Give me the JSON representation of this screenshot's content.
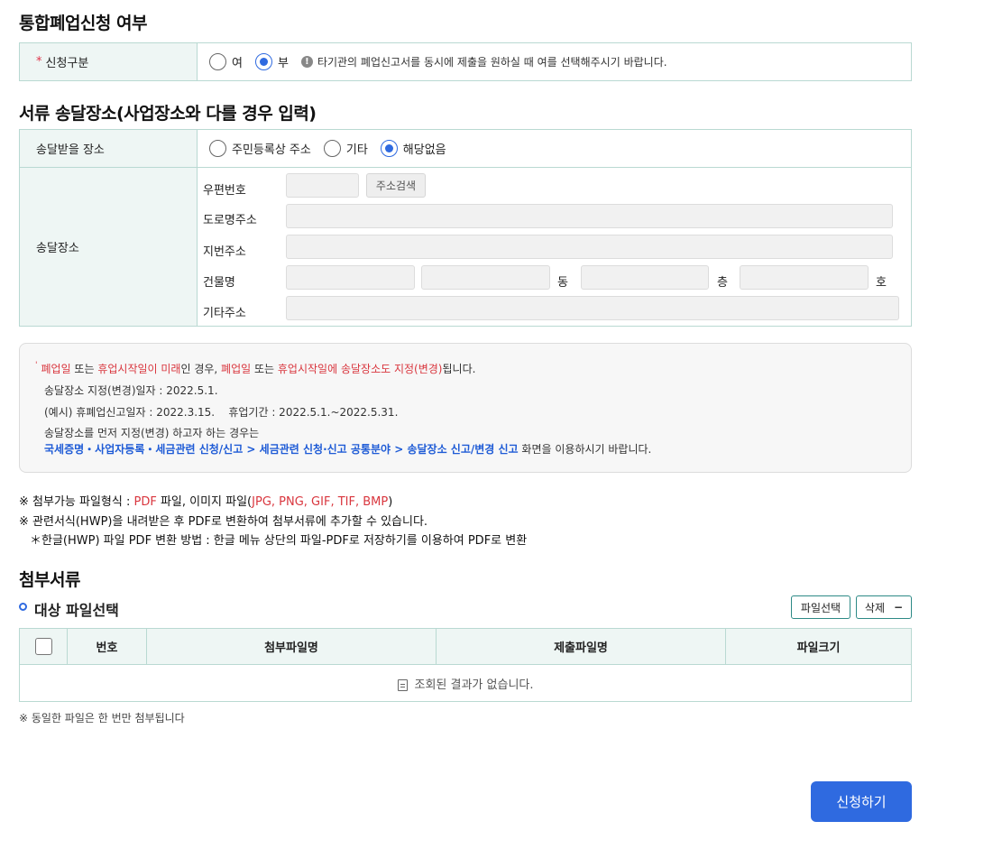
{
  "section1": {
    "title": "통합폐업신청 여부",
    "label": "신청구분",
    "options": [
      "여",
      "부"
    ],
    "selected": "부",
    "hint": "타기관의 폐업신고서를 동시에 제출을 원하실 때 여를 선택해주시기 바랍니다."
  },
  "section2": {
    "title": "서류 송달장소(사업장소와 다를 경우 입력)",
    "place_label": "송달받을 장소",
    "place_options": [
      "주민등록상 주소",
      "기타",
      "해당없음"
    ],
    "place_selected": "해당없음",
    "addr_label": "송달장소",
    "postal_label": "우편번호",
    "search_button": "주소검색",
    "road_label": "도로명주소",
    "jibun_label": "지번주소",
    "building_label": "건물명",
    "dong": "동",
    "floor": "층",
    "ho": "호",
    "etc_label": "기타주소"
  },
  "notice": {
    "line1_a": "폐업일",
    "line1_b": " 또는 ",
    "line1_c": "휴업시작일이 미래",
    "line1_d": "인 경우, ",
    "line1_e": "폐업일",
    "line1_f": " 또는 ",
    "line1_g": "휴업시작일에 송달장소도 지정(변경)",
    "line1_h": "됩니다.",
    "line2": "송달장소 지정(변경)일자 : 2022.5.1.",
    "line3": "(예시) 휴폐업신고일자 : 2022.3.15.    휴업기간 : 2022.5.1.~2022.5.31.",
    "line4": "송달장소를 먼저 지정(변경) 하고자 하는 경우는",
    "line5_link": "국세증명・사업자등록・세금관련 신청/신고 > 세금관련 신청·신고 공통분야 > 송달장소 신고/변경 신고",
    "line5_tail": " 화면을 이용하시기 바랍니다."
  },
  "guide": {
    "g1_a": "※ 첨부가능 파일형식 : ",
    "g1_b": "PDF",
    "g1_c": " 파일, 이미지 파일(",
    "g1_d": "JPG, PNG, GIF, TIF, BMP",
    "g1_e": ")",
    "g2": "※ 관련서식(HWP)을 내려받은 후 PDF로 변환하여 첨부서류에 추가할 수 있습니다.",
    "g3": "＊한글(HWP) 파일 PDF 변환 방법 : 한글 메뉴 상단의 파일-PDF로 저장하기를 이용하여 PDF로 변환"
  },
  "attach": {
    "title": "첨부서류",
    "subtitle": "대상 파일선택",
    "select_button": "파일선택",
    "delete_button": "삭제",
    "columns": [
      "번호",
      "첨부파일명",
      "제출파일명",
      "파일크기"
    ],
    "empty": "조회된 결과가 없습니다.",
    "note": "※ 동일한 파일은 한 번만 첨부됩니다"
  },
  "submit_label": "신청하기",
  "colors": {
    "accent": "#2f6ae0",
    "border": "#b9d9d2",
    "label_bg": "#eef6f4",
    "warn": "#d9363e"
  }
}
